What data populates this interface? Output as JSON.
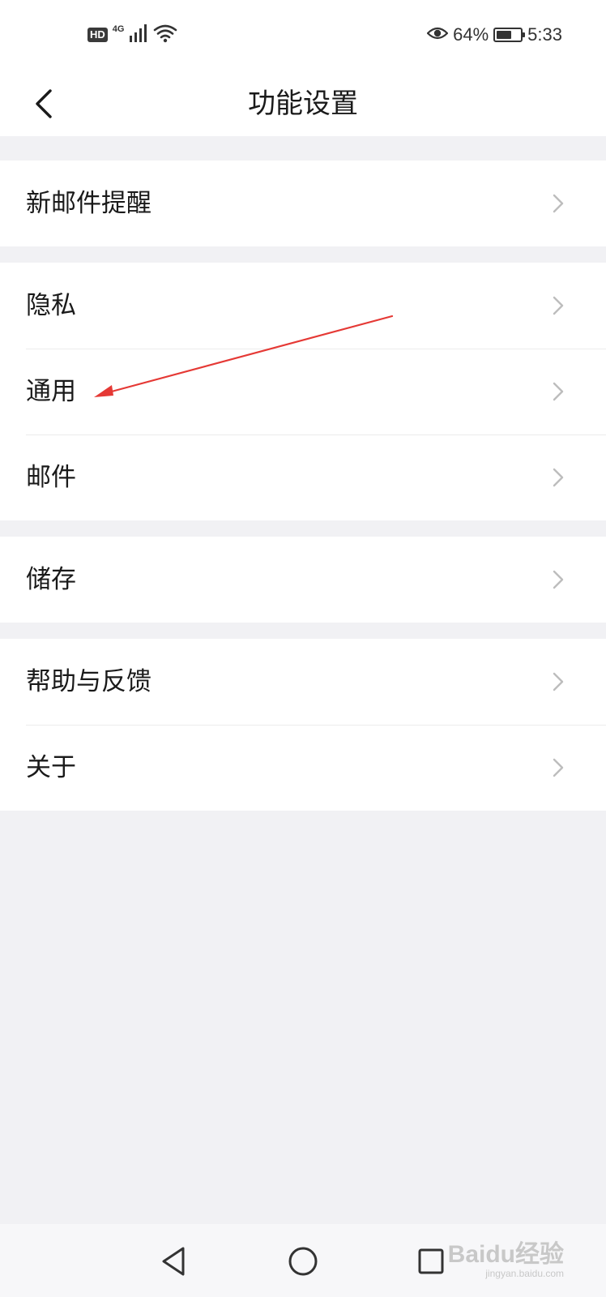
{
  "status_bar": {
    "hd_label": "HD",
    "network_type": "4G",
    "battery_text": "64%",
    "battery_level": 0.64,
    "time": "5:33"
  },
  "header": {
    "title": "功能设置"
  },
  "groups": [
    {
      "items": [
        {
          "label": "新邮件提醒"
        }
      ]
    },
    {
      "items": [
        {
          "label": "隐私"
        },
        {
          "label": "通用"
        },
        {
          "label": "邮件"
        }
      ]
    },
    {
      "items": [
        {
          "label": "储存"
        }
      ]
    },
    {
      "items": [
        {
          "label": "帮助与反馈"
        },
        {
          "label": "关于"
        }
      ]
    }
  ],
  "annotation": {
    "color": "#e53935",
    "target": "通用"
  },
  "watermark": {
    "main": "Baidu经验",
    "sub": "jingyan.baidu.com"
  },
  "colors": {
    "background": "#f1f1f4",
    "surface": "#ffffff",
    "text": "#1a1a1a",
    "chevron": "#bdbdbd"
  }
}
